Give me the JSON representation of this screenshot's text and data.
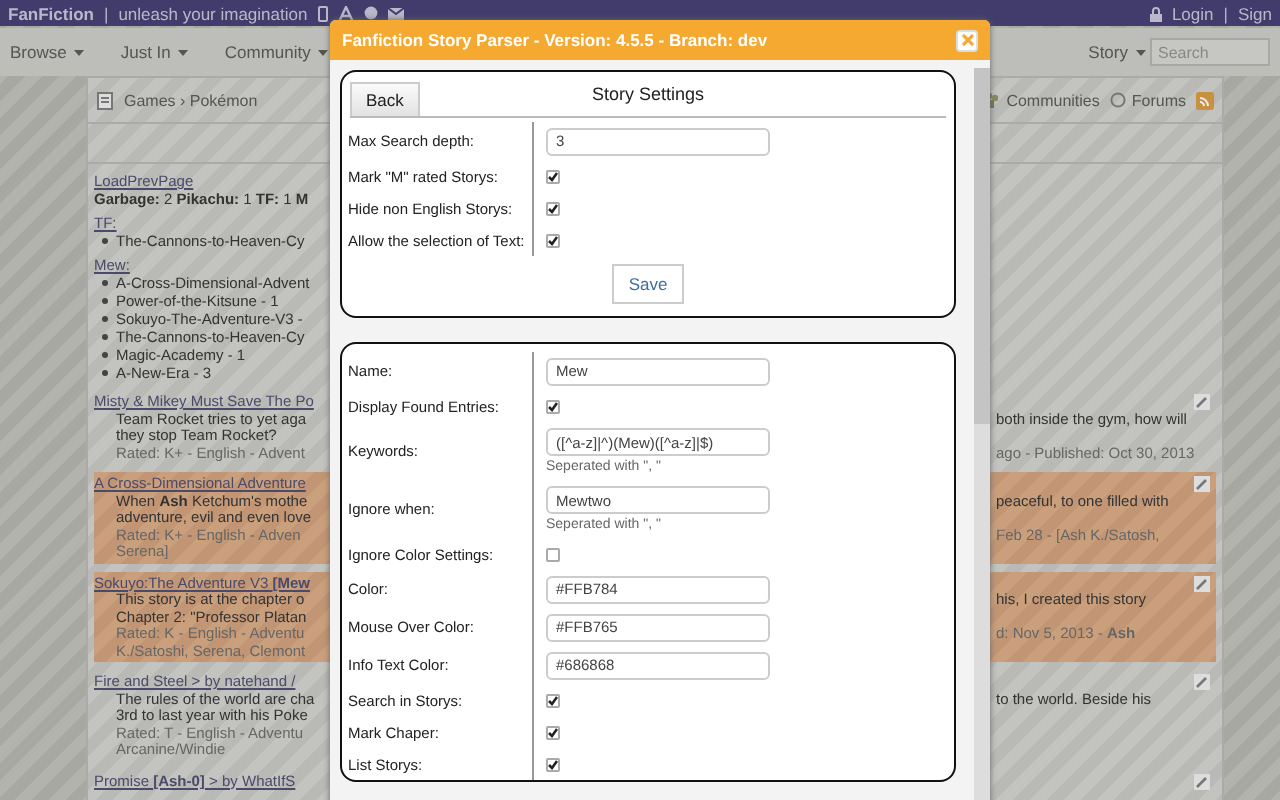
{
  "top_bar": {
    "brand": "FanFiction",
    "separator": "|",
    "tagline": "unleash your imagination",
    "login": "Login",
    "divider": "|",
    "sign_up": "Sign"
  },
  "nav": {
    "menus": [
      "Browse",
      "Just In",
      "Community"
    ],
    "story_menu": "Story",
    "search": {
      "placeholder": "Search"
    }
  },
  "content_header": {
    "breadcrumb": "Games › Pokémon",
    "links": [
      "Communities",
      "Forums"
    ]
  },
  "summary": [
    {
      "kind": "link",
      "text": "LoadPrevPage"
    },
    {
      "kind": "counts",
      "text": "**Garbage:** 2 **Pikachu:** 1 **TF:** 1 **M**"
    },
    {
      "kind": "group",
      "text": "TF:"
    },
    {
      "kind": "bullet",
      "text": "The-Cannons-to-Heaven-Cy"
    },
    {
      "kind": "group",
      "text": "Mew:"
    },
    {
      "kind": "bullet",
      "text": "A-Cross-Dimensional-Advent"
    },
    {
      "kind": "bullet",
      "text": "Power-of-the-Kitsune - 1"
    },
    {
      "kind": "bullet",
      "text": "Sokuyo-The-Adventure-V3 -"
    },
    {
      "kind": "bullet",
      "text": "The-Cannons-to-Heaven-Cy"
    },
    {
      "kind": "bullet",
      "text": "Magic-Academy - 1"
    },
    {
      "kind": "bullet",
      "text": "A-New-Era - 3"
    }
  ],
  "stories": [
    {
      "highlighted": false,
      "lines": [
        {
          "kind": "title",
          "left": "Misty & Mikey Must Save The Po"
        },
        {
          "kind": "text",
          "left": "Team Rocket tries to yet aga",
          "right": "both inside the gym, how will"
        },
        {
          "kind": "text",
          "left": "they stop Team Rocket?"
        },
        {
          "kind": "meta",
          "left": "Rated: K+ - English - Advent",
          "right": "ago - Published: Oct 30, 2013"
        }
      ]
    },
    {
      "highlighted": true,
      "lines": [
        {
          "kind": "title",
          "left": "A Cross-Dimensional Adventure"
        },
        {
          "kind": "text",
          "left": "When **Ash** Ketchum's mothe",
          "right": "peaceful, to one filled with"
        },
        {
          "kind": "text",
          "left": "adventure, evil and even love"
        },
        {
          "kind": "meta",
          "left": "Rated: K+ - English - Adven",
          "right": "Feb 28 - [Ash K./Satosh,"
        },
        {
          "kind": "meta",
          "left": "Serena]"
        }
      ]
    },
    {
      "highlighted": true,
      "lines": [
        {
          "kind": "title",
          "left": "Sokuyo:The Adventure V3 **[Mew**"
        },
        {
          "kind": "text",
          "left": "This story is at the chapter o",
          "right": "his, I created this story"
        },
        {
          "kind": "text",
          "left": "Chapter 2: \"Professor Platan"
        },
        {
          "kind": "meta",
          "left": "Rated: K - English - Adventu",
          "right": "d: Nov 5, 2013 - **Ash**"
        },
        {
          "kind": "meta",
          "left": "K./Satoshi, Serena, Clemont"
        }
      ]
    },
    {
      "highlighted": false,
      "lines": [
        {
          "kind": "title",
          "left": "Fire and Steel > by natehand /"
        },
        {
          "kind": "text",
          "left": "The rules of the world are cha",
          "right": "to the world. Beside his"
        },
        {
          "kind": "text",
          "left": "3rd to last year with his Poke"
        },
        {
          "kind": "meta",
          "left": "Rated: T - English - Adventu"
        },
        {
          "kind": "meta",
          "left": "Arcanine/Windie"
        }
      ]
    },
    {
      "highlighted": false,
      "lines": [
        {
          "kind": "title",
          "left": "Promise **[Ash-0]** > by WhatIfS"
        }
      ]
    }
  ],
  "dialog": {
    "title": "Fanfiction Story Parser - Version: 4.5.5 - Branch: dev",
    "settings_panel": {
      "back": "Back",
      "title": "Story Settings",
      "save": "Save",
      "rows": [
        {
          "label": "Max Search depth:",
          "kind": "text",
          "value": "3"
        },
        {
          "label": "Mark \"M\" rated Storys:",
          "kind": "checkbox",
          "checked": true
        },
        {
          "label": "Hide non English Storys:",
          "kind": "checkbox",
          "checked": true
        },
        {
          "label": "Allow the selection of Text:",
          "kind": "checkbox",
          "checked": true
        }
      ]
    },
    "entry_panel": {
      "rows": [
        {
          "label": "Name:",
          "kind": "text",
          "value": "Mew"
        },
        {
          "label": "Display Found Entries:",
          "kind": "checkbox",
          "checked": true
        },
        {
          "label": "Keywords:",
          "kind": "text",
          "value": "([^a-z]|^)(Mew)([^a-z]|$)",
          "hint": "Seperated with \", \""
        },
        {
          "label": "Ignore when:",
          "kind": "text",
          "value": "Mewtwo",
          "hint": "Seperated with \", \""
        },
        {
          "label": "Ignore Color Settings:",
          "kind": "checkbox",
          "checked": false
        },
        {
          "label": "Color:",
          "kind": "text",
          "value": "#FFB784"
        },
        {
          "label": "Mouse Over Color:",
          "kind": "text",
          "value": "#FFB765"
        },
        {
          "label": "Info Text Color:",
          "kind": "text",
          "value": "#686868"
        },
        {
          "label": "Search in Storys:",
          "kind": "checkbox",
          "checked": true
        },
        {
          "label": "Mark Chaper:",
          "kind": "checkbox",
          "checked": true
        },
        {
          "label": "List Storys:",
          "kind": "checkbox",
          "checked": true
        }
      ]
    }
  }
}
